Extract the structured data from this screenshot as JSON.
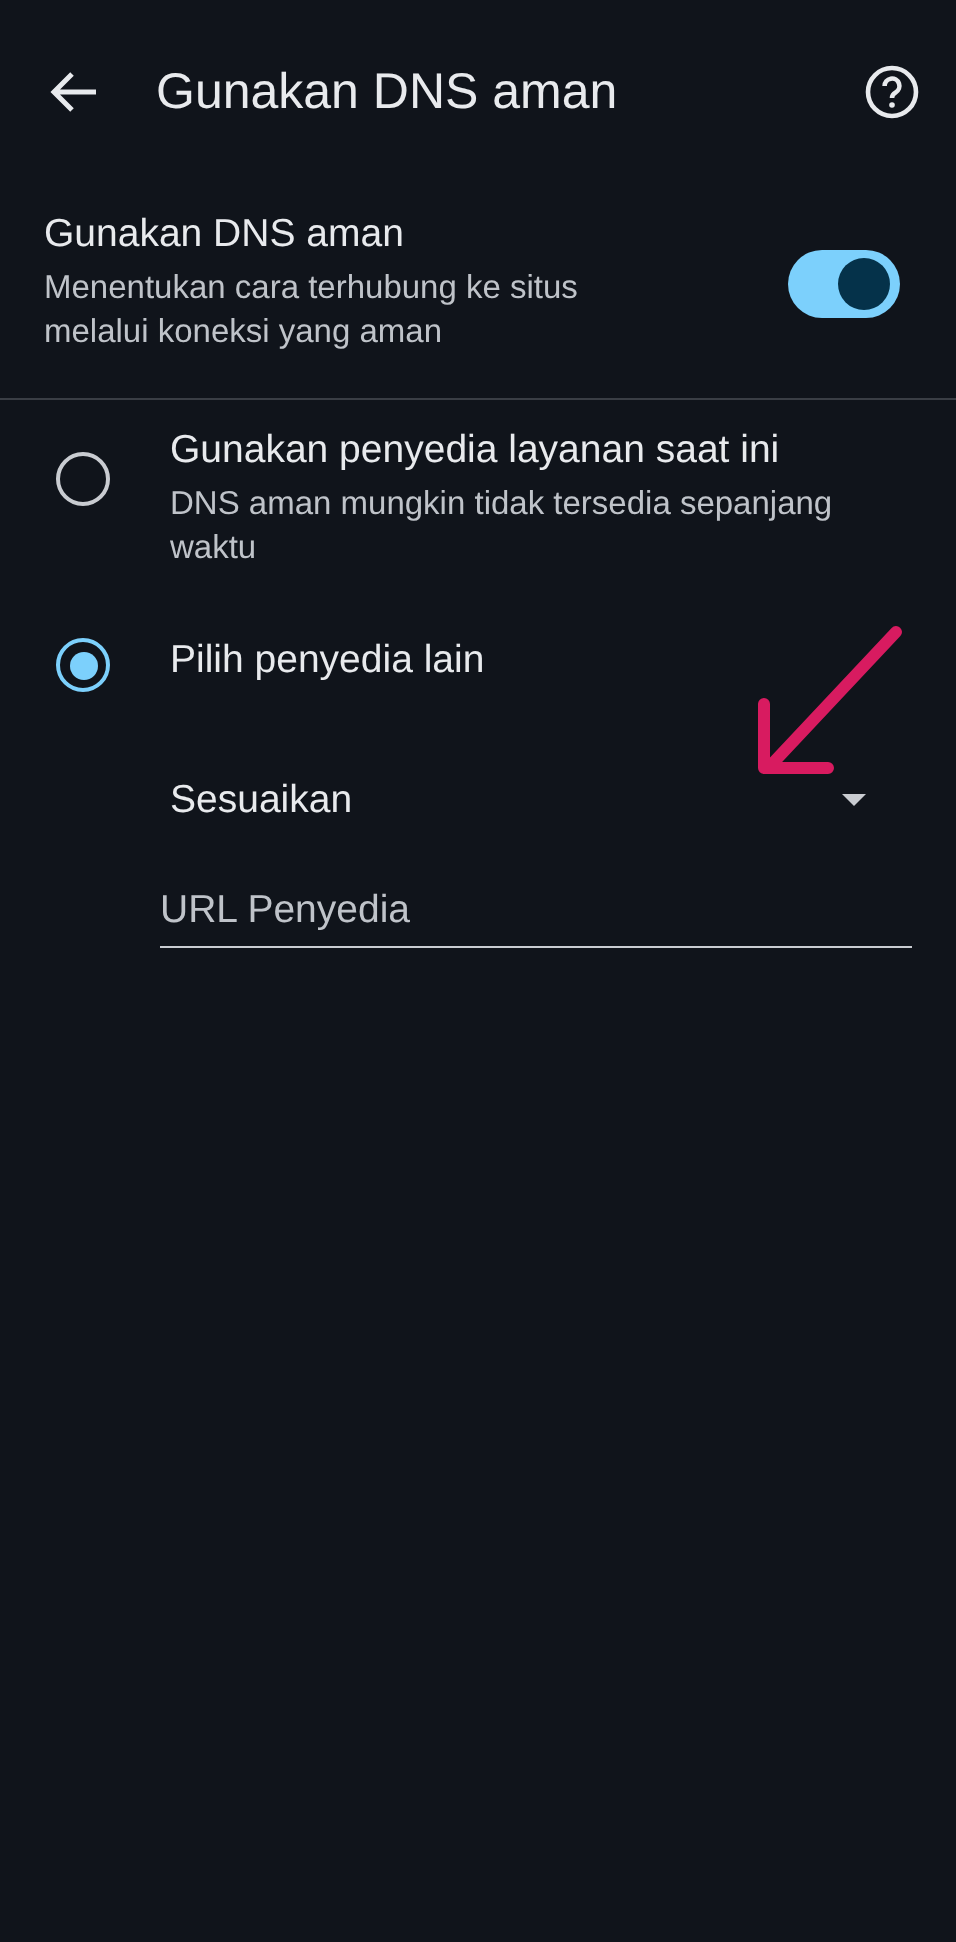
{
  "header": {
    "title": "Gunakan DNS aman"
  },
  "setting": {
    "title": "Gunakan DNS aman",
    "description": "Menentukan cara terhubung ke situs melalui koneksi yang aman",
    "on": true
  },
  "options": [
    {
      "title": "Gunakan penyedia layanan saat ini",
      "description": "DNS aman mungkin tidak tersedia sepanjang waktu",
      "selected": false
    },
    {
      "title": "Pilih penyedia lain",
      "selected": true
    }
  ],
  "provider_dropdown": {
    "value": "Sesuaikan"
  },
  "provider_field": {
    "placeholder": "URL Penyedia"
  }
}
